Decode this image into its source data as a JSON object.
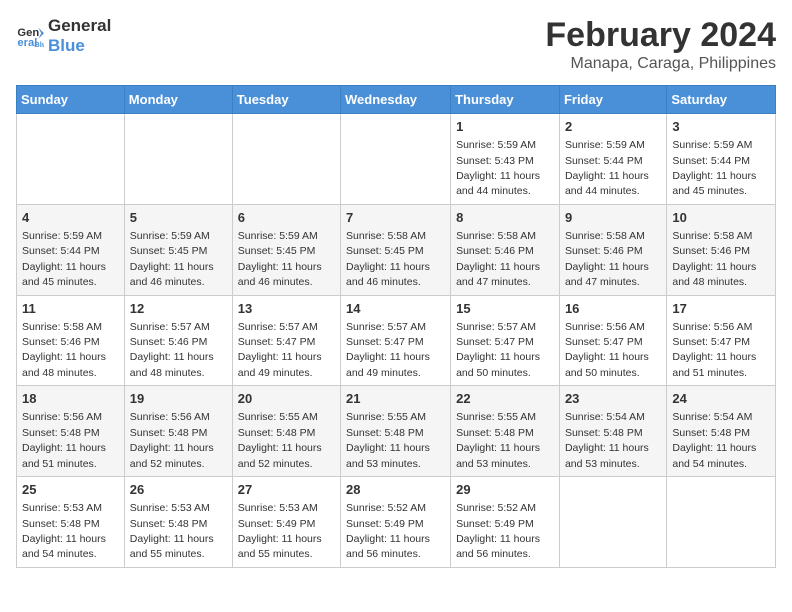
{
  "logo": {
    "line1": "General",
    "line2": "Blue"
  },
  "title": "February 2024",
  "subtitle": "Manapa, Caraga, Philippines",
  "days_of_week": [
    "Sunday",
    "Monday",
    "Tuesday",
    "Wednesday",
    "Thursday",
    "Friday",
    "Saturday"
  ],
  "weeks": [
    [
      {
        "day": "",
        "info": ""
      },
      {
        "day": "",
        "info": ""
      },
      {
        "day": "",
        "info": ""
      },
      {
        "day": "",
        "info": ""
      },
      {
        "day": "1",
        "info": "Sunrise: 5:59 AM\nSunset: 5:43 PM\nDaylight: 11 hours and 44 minutes."
      },
      {
        "day": "2",
        "info": "Sunrise: 5:59 AM\nSunset: 5:44 PM\nDaylight: 11 hours and 44 minutes."
      },
      {
        "day": "3",
        "info": "Sunrise: 5:59 AM\nSunset: 5:44 PM\nDaylight: 11 hours and 45 minutes."
      }
    ],
    [
      {
        "day": "4",
        "info": "Sunrise: 5:59 AM\nSunset: 5:44 PM\nDaylight: 11 hours and 45 minutes."
      },
      {
        "day": "5",
        "info": "Sunrise: 5:59 AM\nSunset: 5:45 PM\nDaylight: 11 hours and 46 minutes."
      },
      {
        "day": "6",
        "info": "Sunrise: 5:59 AM\nSunset: 5:45 PM\nDaylight: 11 hours and 46 minutes."
      },
      {
        "day": "7",
        "info": "Sunrise: 5:58 AM\nSunset: 5:45 PM\nDaylight: 11 hours and 46 minutes."
      },
      {
        "day": "8",
        "info": "Sunrise: 5:58 AM\nSunset: 5:46 PM\nDaylight: 11 hours and 47 minutes."
      },
      {
        "day": "9",
        "info": "Sunrise: 5:58 AM\nSunset: 5:46 PM\nDaylight: 11 hours and 47 minutes."
      },
      {
        "day": "10",
        "info": "Sunrise: 5:58 AM\nSunset: 5:46 PM\nDaylight: 11 hours and 48 minutes."
      }
    ],
    [
      {
        "day": "11",
        "info": "Sunrise: 5:58 AM\nSunset: 5:46 PM\nDaylight: 11 hours and 48 minutes."
      },
      {
        "day": "12",
        "info": "Sunrise: 5:57 AM\nSunset: 5:46 PM\nDaylight: 11 hours and 48 minutes."
      },
      {
        "day": "13",
        "info": "Sunrise: 5:57 AM\nSunset: 5:47 PM\nDaylight: 11 hours and 49 minutes."
      },
      {
        "day": "14",
        "info": "Sunrise: 5:57 AM\nSunset: 5:47 PM\nDaylight: 11 hours and 49 minutes."
      },
      {
        "day": "15",
        "info": "Sunrise: 5:57 AM\nSunset: 5:47 PM\nDaylight: 11 hours and 50 minutes."
      },
      {
        "day": "16",
        "info": "Sunrise: 5:56 AM\nSunset: 5:47 PM\nDaylight: 11 hours and 50 minutes."
      },
      {
        "day": "17",
        "info": "Sunrise: 5:56 AM\nSunset: 5:47 PM\nDaylight: 11 hours and 51 minutes."
      }
    ],
    [
      {
        "day": "18",
        "info": "Sunrise: 5:56 AM\nSunset: 5:48 PM\nDaylight: 11 hours and 51 minutes."
      },
      {
        "day": "19",
        "info": "Sunrise: 5:56 AM\nSunset: 5:48 PM\nDaylight: 11 hours and 52 minutes."
      },
      {
        "day": "20",
        "info": "Sunrise: 5:55 AM\nSunset: 5:48 PM\nDaylight: 11 hours and 52 minutes."
      },
      {
        "day": "21",
        "info": "Sunrise: 5:55 AM\nSunset: 5:48 PM\nDaylight: 11 hours and 53 minutes."
      },
      {
        "day": "22",
        "info": "Sunrise: 5:55 AM\nSunset: 5:48 PM\nDaylight: 11 hours and 53 minutes."
      },
      {
        "day": "23",
        "info": "Sunrise: 5:54 AM\nSunset: 5:48 PM\nDaylight: 11 hours and 53 minutes."
      },
      {
        "day": "24",
        "info": "Sunrise: 5:54 AM\nSunset: 5:48 PM\nDaylight: 11 hours and 54 minutes."
      }
    ],
    [
      {
        "day": "25",
        "info": "Sunrise: 5:53 AM\nSunset: 5:48 PM\nDaylight: 11 hours and 54 minutes."
      },
      {
        "day": "26",
        "info": "Sunrise: 5:53 AM\nSunset: 5:48 PM\nDaylight: 11 hours and 55 minutes."
      },
      {
        "day": "27",
        "info": "Sunrise: 5:53 AM\nSunset: 5:49 PM\nDaylight: 11 hours and 55 minutes."
      },
      {
        "day": "28",
        "info": "Sunrise: 5:52 AM\nSunset: 5:49 PM\nDaylight: 11 hours and 56 minutes."
      },
      {
        "day": "29",
        "info": "Sunrise: 5:52 AM\nSunset: 5:49 PM\nDaylight: 11 hours and 56 minutes."
      },
      {
        "day": "",
        "info": ""
      },
      {
        "day": "",
        "info": ""
      }
    ]
  ]
}
